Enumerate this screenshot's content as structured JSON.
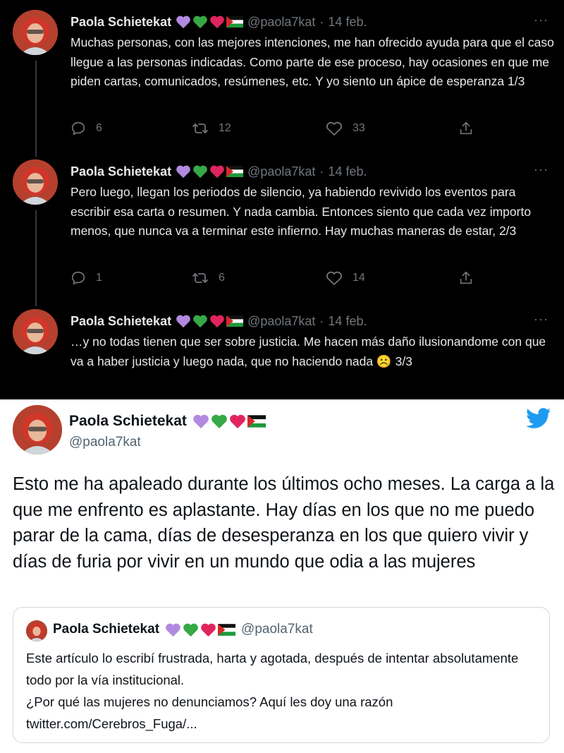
{
  "colors": {
    "dark_bg": "#000000",
    "dark_text": "#e7e9ea",
    "dark_muted": "#71767b",
    "light_text": "#0f1419",
    "light_muted": "#536471",
    "twitter_blue": "#1d9bf0",
    "heart_purple": "#b18ae0",
    "heart_green": "#36a845",
    "heart_red": "#e0245e"
  },
  "icons": {
    "name_emoji": [
      "purple-heart-icon",
      "green-heart-icon",
      "red-heart-icon",
      "palestine-flag-icon"
    ],
    "actions": [
      "reply-icon",
      "retweet-icon",
      "like-icon",
      "share-icon"
    ],
    "more": "more-options-icon",
    "brand": "twitter-bird-icon"
  },
  "thread": [
    {
      "name": "Paola Schietekat",
      "handle": "@paola7kat",
      "date": "14 feb.",
      "more": "···",
      "text": "Muchas personas, con las mejores intenciones, me han ofrecido ayuda para que el caso llegue a las personas indicadas. Como parte de ese proceso, hay ocasiones en que me piden cartas, comunicados, resúmenes, etc. Y yo siento un ápice de esperanza 1/3",
      "replies": "6",
      "retweets": "12",
      "likes": "33"
    },
    {
      "name": "Paola Schietekat",
      "handle": "@paola7kat",
      "date": "14 feb.",
      "more": "···",
      "text": "Pero luego, llegan los periodos de silencio, ya habiendo revivido los eventos para escribir esa carta o resumen. Y nada cambia. Entonces siento que cada vez importo menos, que nunca va a terminar este infierno. Hay muchas maneras de estar, 2/3",
      "replies": "1",
      "retweets": "6",
      "likes": "14"
    },
    {
      "name": "Paola Schietekat",
      "handle": "@paola7kat",
      "date": "14 feb.",
      "more": "···",
      "text": "…y no todas tienen que ser sobre justicia. Me hacen más daño ilusionandome con que va a haber justicia y luego nada, que no haciendo nada ☹️ 3/3"
    }
  ],
  "main_tweet": {
    "name": "Paola Schietekat",
    "handle": "@paola7kat",
    "text": "Esto me ha apaleado durante los últimos ocho meses. La carga a la que me enfrento es aplastante. Hay días en los que no me puedo parar de la cama, días de desesperanza en los que quiero vivir y días de furia por vivir en un mundo que odia a las mujeres"
  },
  "quoted_tweet": {
    "name": "Paola Schietekat",
    "handle": "@paola7kat",
    "line1": "Este artículo lo escribí frustrada, harta y agotada, después de intentar absolutamente todo por la vía institucional.",
    "line2": "¿Por qué las mujeres no denunciamos? Aquí les doy una razón",
    "link": "twitter.com/Cerebros_Fuga/..."
  }
}
